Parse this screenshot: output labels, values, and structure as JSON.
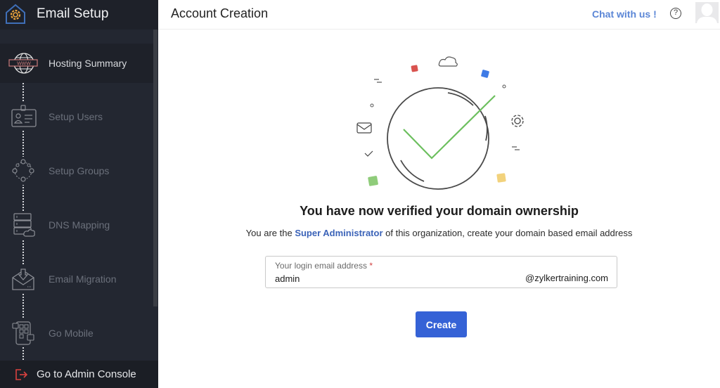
{
  "app": {
    "title": "Email Setup"
  },
  "sidebar": {
    "items": [
      {
        "label": "Hosting Summary",
        "icon": "globe-www-icon",
        "active": true
      },
      {
        "label": "Setup Users",
        "icon": "id-badge-icon",
        "active": false
      },
      {
        "label": "Setup Groups",
        "icon": "group-network-icon",
        "active": false
      },
      {
        "label": "DNS Mapping",
        "icon": "server-cloud-icon",
        "active": false
      },
      {
        "label": "Email Migration",
        "icon": "envelope-download-icon",
        "active": false
      },
      {
        "label": "Go Mobile",
        "icon": "mobile-apps-icon",
        "active": false
      }
    ],
    "footer": {
      "label": "Go to Admin Console",
      "icon": "exit-icon"
    }
  },
  "header": {
    "title": "Account Creation",
    "chat_link": "Chat with us !",
    "help_icon": "?"
  },
  "main": {
    "headline": "You have now verified your domain ownership",
    "subtext_before": "You are the ",
    "subtext_highlight": "Super Administrator",
    "subtext_after": " of this organization, create your domain based email address",
    "email_field": {
      "label": "Your login email address",
      "required_mark": "*",
      "value": "admin",
      "suffix": "@zylkertraining.com"
    },
    "create_button": "Create"
  },
  "colors": {
    "sidebar_bg": "#232731",
    "accent_blue": "#3562d6",
    "link_blue": "#5b86d6",
    "check_green": "#6cbf5e",
    "logo_orange": "#e8a33c"
  }
}
